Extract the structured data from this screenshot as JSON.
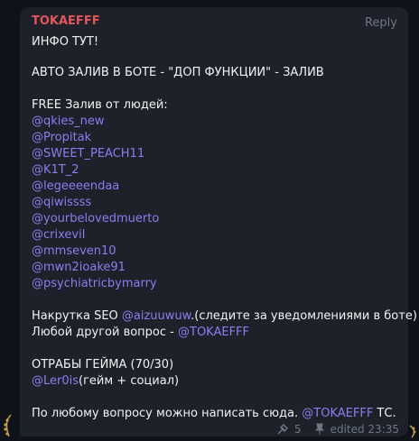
{
  "message": {
    "sender": "TOKAEFFF",
    "reply_label": "Reply",
    "lines": {
      "l1": "ИНФО ТУТ!",
      "l2": "АВТО ЗАЛИВ В БОТЕ - \"ДОП ФУНКЦИИ\" - ЗАЛИВ",
      "l3": "FREE Залив от людей:",
      "m1": "@qkies_new",
      "m2": "@Propitak",
      "m3": "@SWEET_PEACH11",
      "m4": "@K1T_2",
      "m5": "@legeeeendaa",
      "m6": "@qiwissss",
      "m7": "@yourbelovedmuerto",
      "m8": "@crixevil",
      "m9": "@mmseven10",
      "m10": "@mwn2ioake91",
      "m11": "@psychiatricbymarry",
      "seo_prefix": "Накрутка SEO ",
      "seo_mention": "@aizuuwuw",
      "seo_suffix": ".(следите за уведомлениями в боте)",
      "other_prefix": "Любой другой вопрос -  ",
      "other_mention": "@TOKAEFFF",
      "otr": "ОТРАБЫ ГЕЙМА (70/30)",
      "ler_mention": "@Ler0is",
      "ler_suffix": "(гейм + социал)",
      "final_prefix": "По любому вопросу можно написать сюда. ",
      "final_mention": "@TOKAEFFF",
      "final_suffix": " ТС."
    },
    "meta": {
      "reactions_count": "5",
      "edited_label": "edited 23:35"
    }
  },
  "colors": {
    "background": "#0f1319",
    "bubble": "#1e2129",
    "sender": "#e2555b",
    "mention": "#8e7cf0",
    "text": "#f2f2f2",
    "meta": "#6c7883"
  }
}
